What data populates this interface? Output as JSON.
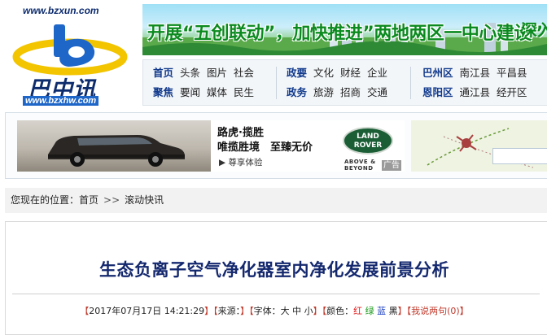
{
  "logo": {
    "url_top": "www.bzxun.com",
    "brand": "巴中讯",
    "url_bottom": "www.bzxhw.com",
    "colors": {
      "swoosh_yellow": "#f2c500",
      "swoosh_blue": "#1e66c8",
      "brand_navy": "#0d2c6e"
    }
  },
  "banner": {
    "slogan": "开展“五创联动”，加快推进”两地两区一中心建设”",
    "slogan_tail": "深入"
  },
  "nav": {
    "group1": {
      "row1": [
        {
          "label": "首页",
          "highlight": true
        },
        {
          "label": "头条"
        },
        {
          "label": "图片"
        },
        {
          "label": "社会"
        }
      ],
      "row2": [
        {
          "label": "聚焦",
          "highlight": true
        },
        {
          "label": "要闻"
        },
        {
          "label": "媒体"
        },
        {
          "label": "民生"
        }
      ]
    },
    "group2": {
      "row1": [
        {
          "label": "政要",
          "highlight": true
        },
        {
          "label": "文化"
        },
        {
          "label": "财经"
        },
        {
          "label": "企业"
        }
      ],
      "row2": [
        {
          "label": "政务",
          "highlight": true
        },
        {
          "label": "旅游"
        },
        {
          "label": "招商"
        },
        {
          "label": "交通"
        }
      ]
    },
    "group3": {
      "row1": [
        {
          "label": "巴州区",
          "highlight": true
        },
        {
          "label": "南江县"
        },
        {
          "label": "平昌县"
        }
      ],
      "row2": [
        {
          "label": "恩阳区",
          "highlight": true
        },
        {
          "label": "通江县"
        },
        {
          "label": "经开区"
        }
      ]
    }
  },
  "ad": {
    "line1": "路虎·揽胜",
    "line2": "唯揽胜境　至臻无价",
    "cta": "尊享体验",
    "brand_logo": "LAND ROVER",
    "brand_tag": "ABOVE & BEYOND",
    "label": "广告"
  },
  "breadcrumb": {
    "prefix": "您现在的位置：",
    "home": "首页",
    "separator": ">>",
    "current": "滚动快讯"
  },
  "article": {
    "title": "生态负离子空气净化器室内净化发展前景分析",
    "meta": {
      "date": "2017年07月17日 14:21:29",
      "source_label": "来源：",
      "source_value": "",
      "font_label": "字体：",
      "font_sizes": [
        "大",
        "中",
        "小"
      ],
      "color_label": "颜色：",
      "colors": [
        "红",
        "绿",
        "蓝",
        "黑"
      ],
      "comments": "我说两句(0)"
    }
  }
}
